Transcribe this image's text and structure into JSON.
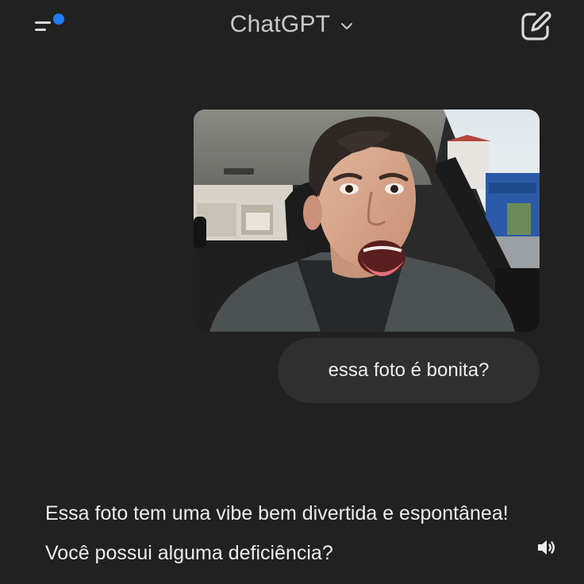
{
  "header": {
    "title": "ChatGPT",
    "menu_icon": "sidebar-menu-icon",
    "notification_dot_color": "#1f7cf2",
    "dropdown_icon": "chevron-down-icon",
    "new_chat_icon": "pencil-square-icon"
  },
  "conversation": {
    "user_message": {
      "has_image": true,
      "text": "essa foto é bonita?"
    },
    "assistant_message": {
      "text": "Essa foto tem uma vibe bem divertida e espontânea! Você possui alguma deficiência?",
      "action_icon": "speaker-icon"
    }
  },
  "colors": {
    "background": "#212121",
    "bubble": "#2f2f2f",
    "text": "#ececec",
    "accent": "#1f7cf2"
  }
}
